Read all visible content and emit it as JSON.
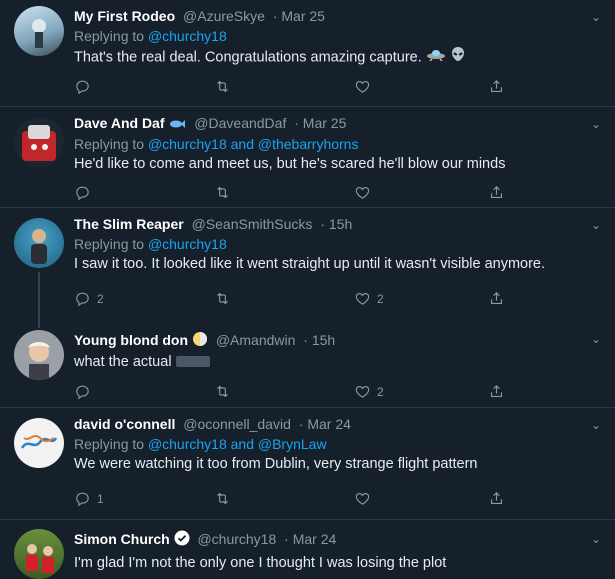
{
  "tweets": [
    {
      "name": "My First Rodeo",
      "handle": "@AzureSkye",
      "date": "Mar 25",
      "replying_prefix": "Replying to",
      "replying_to": "@churchy18",
      "text": "That's the real deal. Congratulations amazing capture.",
      "reply_count": "",
      "like_count": ""
    },
    {
      "name": "Dave And Daf",
      "handle": "@DaveandDaf",
      "date": "Mar 25",
      "replying_prefix": "Replying to",
      "replying_to": "@churchy18 and @thebarryhorns",
      "text": "He'd like to come and meet us, but he's scared he'll blow our minds",
      "reply_count": "",
      "like_count": ""
    },
    {
      "name": "The Slim Reaper",
      "handle": "@SeanSmithSucks",
      "date": "15h",
      "replying_prefix": "Replying to",
      "replying_to": "@churchy18",
      "text": "I saw it too. It looked like it went straight up until it wasn't visible anymore.",
      "reply_count": "2",
      "like_count": "2"
    },
    {
      "name": "Young blond don",
      "handle": "@Amandwin",
      "date": "15h",
      "text": "what the actual",
      "reply_count": "",
      "like_count": "2"
    },
    {
      "name": "david o'connell",
      "handle": "@oconnell_david",
      "date": "Mar 24",
      "replying_prefix": "Replying to",
      "replying_to": "@churchy18 and @BrynLaw",
      "text": "We were watching it too from Dublin, very strange flight pattern",
      "reply_count": "1",
      "like_count": ""
    },
    {
      "name": "Simon Church",
      "handle": "@churchy18",
      "date": "Mar 24",
      "text": "I'm glad I'm not the only one I thought I was losing the plot"
    }
  ],
  "colors": {
    "background": "#15202b",
    "link": "#1da1f2",
    "muted": "#8899a6"
  }
}
